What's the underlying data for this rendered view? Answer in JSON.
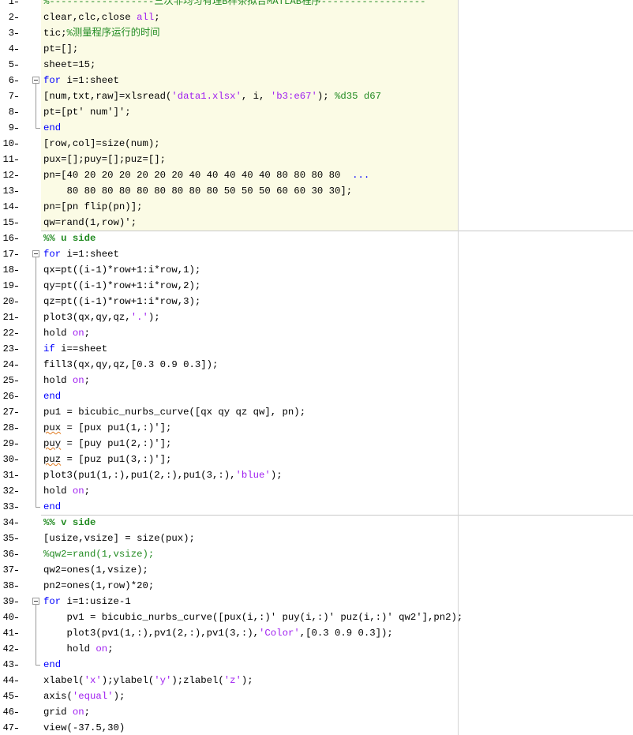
{
  "editor": {
    "lines": [
      {
        "n": "1",
        "segs": [
          {
            "t": "cmt",
            "v": "%------------------三次非均匀有理B样条拟合MATLAB程序------------------"
          }
        ]
      },
      {
        "n": "2",
        "segs": [
          {
            "t": "plain",
            "v": "clear,clc,close "
          },
          {
            "t": "str",
            "v": "all"
          },
          {
            "t": "plain",
            "v": ";"
          }
        ]
      },
      {
        "n": "3",
        "segs": [
          {
            "t": "plain",
            "v": "tic;"
          },
          {
            "t": "cmt",
            "v": "%测量程序运行的时间"
          }
        ]
      },
      {
        "n": "4",
        "segs": [
          {
            "t": "plain",
            "v": "pt=[];"
          }
        ]
      },
      {
        "n": "5",
        "segs": [
          {
            "t": "plain",
            "v": "sheet=15;"
          }
        ]
      },
      {
        "n": "6",
        "segs": [
          {
            "t": "kw",
            "v": "for"
          },
          {
            "t": "plain",
            "v": " i=1:sheet"
          }
        ]
      },
      {
        "n": "7",
        "segs": [
          {
            "t": "plain",
            "v": "[num,txt,raw]=xlsread("
          },
          {
            "t": "str",
            "v": "'data1.xlsx'"
          },
          {
            "t": "plain",
            "v": ", i, "
          },
          {
            "t": "str",
            "v": "'b3:e67'"
          },
          {
            "t": "plain",
            "v": "); "
          },
          {
            "t": "cmt",
            "v": "%d35 d67"
          }
        ]
      },
      {
        "n": "8",
        "segs": [
          {
            "t": "plain",
            "v": "pt=[pt' num']';"
          }
        ]
      },
      {
        "n": "9",
        "segs": [
          {
            "t": "kw",
            "v": "end"
          }
        ]
      },
      {
        "n": "10",
        "segs": [
          {
            "t": "plain",
            "v": "[row,col]=size(num);"
          }
        ]
      },
      {
        "n": "11",
        "segs": [
          {
            "t": "plain",
            "v": "pux=[];puy=[];puz=[];"
          }
        ]
      },
      {
        "n": "12",
        "segs": [
          {
            "t": "plain",
            "v": "pn=[40 20 20 20 20 20 20 40 40 40 40 40 80 80 80 80  "
          },
          {
            "t": "cont",
            "v": "..."
          }
        ]
      },
      {
        "n": "13",
        "segs": [
          {
            "t": "plain",
            "v": "    80 80 80 80 80 80 80 80 80 50 50 50 60 60 30 30];"
          }
        ]
      },
      {
        "n": "14",
        "segs": [
          {
            "t": "plain",
            "v": "pn=[pn flip(pn)];"
          }
        ]
      },
      {
        "n": "15",
        "segs": [
          {
            "t": "plain",
            "v": "qw=rand(1,row)';"
          }
        ]
      },
      {
        "n": "16",
        "segs": [
          {
            "t": "sec",
            "v": "%% u side"
          }
        ]
      },
      {
        "n": "17",
        "segs": [
          {
            "t": "kw",
            "v": "for"
          },
          {
            "t": "plain",
            "v": " i=1:sheet"
          }
        ]
      },
      {
        "n": "18",
        "segs": [
          {
            "t": "plain",
            "v": "qx=pt((i-1)*row+1:i*row,1);"
          }
        ]
      },
      {
        "n": "19",
        "segs": [
          {
            "t": "plain",
            "v": "qy=pt((i-1)*row+1:i*row,2);"
          }
        ]
      },
      {
        "n": "20",
        "segs": [
          {
            "t": "plain",
            "v": "qz=pt((i-1)*row+1:i*row,3);"
          }
        ]
      },
      {
        "n": "21",
        "segs": [
          {
            "t": "plain",
            "v": "plot3(qx,qy,qz,"
          },
          {
            "t": "str",
            "v": "'.'"
          },
          {
            "t": "plain",
            "v": ");"
          }
        ]
      },
      {
        "n": "22",
        "segs": [
          {
            "t": "plain",
            "v": "hold "
          },
          {
            "t": "str",
            "v": "on"
          },
          {
            "t": "plain",
            "v": ";"
          }
        ]
      },
      {
        "n": "23",
        "segs": [
          {
            "t": "kw",
            "v": "if"
          },
          {
            "t": "plain",
            "v": " i==sheet"
          }
        ]
      },
      {
        "n": "24",
        "segs": [
          {
            "t": "plain",
            "v": "fill3(qx,qy,qz,[0.3 0.9 0.3]);"
          }
        ]
      },
      {
        "n": "25",
        "segs": [
          {
            "t": "plain",
            "v": "hold "
          },
          {
            "t": "str",
            "v": "on"
          },
          {
            "t": "plain",
            "v": ";"
          }
        ]
      },
      {
        "n": "26",
        "segs": [
          {
            "t": "kw",
            "v": "end"
          }
        ]
      },
      {
        "n": "27",
        "segs": [
          {
            "t": "plain",
            "v": "pu1 = bicubic_nurbs_curve([qx qy qz qw], pn);"
          }
        ]
      },
      {
        "n": "28",
        "segs": [
          {
            "t": "squig",
            "v": "pux"
          },
          {
            "t": "plain",
            "v": " = [pux pu1(1,:)'];"
          }
        ]
      },
      {
        "n": "29",
        "segs": [
          {
            "t": "squig",
            "v": "puy"
          },
          {
            "t": "plain",
            "v": " = [puy pu1(2,:)'];"
          }
        ]
      },
      {
        "n": "30",
        "segs": [
          {
            "t": "squig",
            "v": "puz"
          },
          {
            "t": "plain",
            "v": " = [puz pu1(3,:)'];"
          }
        ]
      },
      {
        "n": "31",
        "segs": [
          {
            "t": "plain",
            "v": "plot3(pu1(1,:),pu1(2,:),pu1(3,:),"
          },
          {
            "t": "str",
            "v": "'blue'"
          },
          {
            "t": "plain",
            "v": ");"
          }
        ]
      },
      {
        "n": "32",
        "segs": [
          {
            "t": "plain",
            "v": "hold "
          },
          {
            "t": "str",
            "v": "on"
          },
          {
            "t": "plain",
            "v": ";"
          }
        ]
      },
      {
        "n": "33",
        "segs": [
          {
            "t": "kw",
            "v": "end"
          }
        ]
      },
      {
        "n": "34",
        "segs": [
          {
            "t": "sec",
            "v": "%% v side"
          }
        ]
      },
      {
        "n": "35",
        "segs": [
          {
            "t": "plain",
            "v": "[usize,vsize] = size(pux);"
          }
        ]
      },
      {
        "n": "36",
        "segs": [
          {
            "t": "cmt",
            "v": "%qw2=rand(1,vsize);"
          }
        ]
      },
      {
        "n": "37",
        "segs": [
          {
            "t": "plain",
            "v": "qw2=ones(1,vsize);"
          }
        ]
      },
      {
        "n": "38",
        "segs": [
          {
            "t": "plain",
            "v": "pn2=ones(1,row)*20;"
          }
        ]
      },
      {
        "n": "39",
        "segs": [
          {
            "t": "kw",
            "v": "for"
          },
          {
            "t": "plain",
            "v": " i=1:usize-1"
          }
        ]
      },
      {
        "n": "40",
        "segs": [
          {
            "t": "plain",
            "v": "    pv1 = bicubic_nurbs_curve([pux(i,:)' puy(i,:)' puz(i,:)' qw2'],pn2);"
          }
        ]
      },
      {
        "n": "41",
        "segs": [
          {
            "t": "plain",
            "v": "    plot3(pv1(1,:),pv1(2,:),pv1(3,:),"
          },
          {
            "t": "str",
            "v": "'Color'"
          },
          {
            "t": "plain",
            "v": ",[0.3 0.9 0.3]);"
          }
        ]
      },
      {
        "n": "42",
        "segs": [
          {
            "t": "plain",
            "v": "    hold "
          },
          {
            "t": "str",
            "v": "on"
          },
          {
            "t": "plain",
            "v": ";"
          }
        ]
      },
      {
        "n": "43",
        "segs": [
          {
            "t": "kw",
            "v": "end"
          }
        ]
      },
      {
        "n": "44",
        "segs": [
          {
            "t": "plain",
            "v": "xlabel("
          },
          {
            "t": "str",
            "v": "'x'"
          },
          {
            "t": "plain",
            "v": ");ylabel("
          },
          {
            "t": "str",
            "v": "'y'"
          },
          {
            "t": "plain",
            "v": ");zlabel("
          },
          {
            "t": "str",
            "v": "'z'"
          },
          {
            "t": "plain",
            "v": ");"
          }
        ]
      },
      {
        "n": "45",
        "segs": [
          {
            "t": "plain",
            "v": "axis("
          },
          {
            "t": "str",
            "v": "'equal'"
          },
          {
            "t": "plain",
            "v": ");"
          }
        ]
      },
      {
        "n": "46",
        "segs": [
          {
            "t": "plain",
            "v": "grid "
          },
          {
            "t": "str",
            "v": "on"
          },
          {
            "t": "plain",
            "v": ";"
          }
        ]
      },
      {
        "n": "47",
        "segs": [
          {
            "t": "plain",
            "v": "view(-37.5,30)"
          }
        ]
      }
    ]
  }
}
